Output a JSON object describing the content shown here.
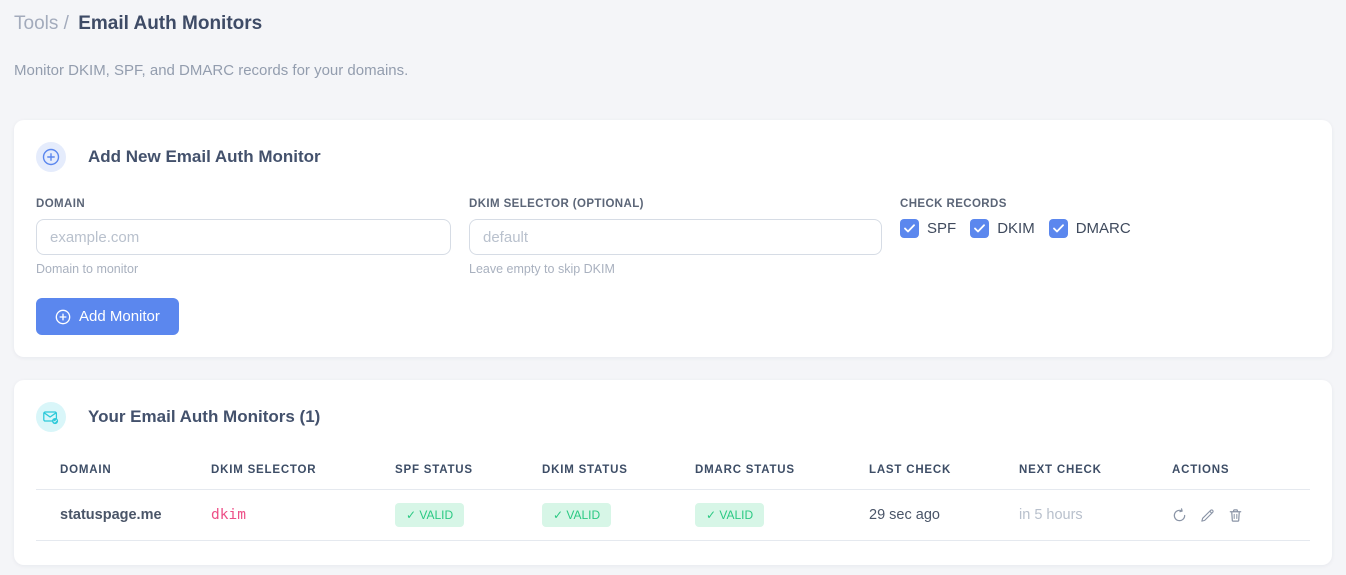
{
  "page": {
    "breadcrumb": {
      "section": "Tools",
      "separator": "/",
      "current": "Email Auth Monitors"
    },
    "subtitle": "Monitor DKIM, SPF, and DMARC records for your domains."
  },
  "add_monitor_card": {
    "title": "Add New Email Auth Monitor",
    "domain_field": {
      "label": "DOMAIN",
      "placeholder": "example.com",
      "value": "",
      "helper": "Domain to monitor"
    },
    "dkim_field": {
      "label": "DKIM SELECTOR (OPTIONAL)",
      "placeholder": "default",
      "value": "",
      "helper": "Leave empty to skip DKIM"
    },
    "check_records": {
      "label": "CHECK RECORDS",
      "options": [
        {
          "label": "SPF",
          "checked": true
        },
        {
          "label": "DKIM",
          "checked": true
        },
        {
          "label": "DMARC",
          "checked": true
        }
      ]
    },
    "submit_label": "Add Monitor"
  },
  "monitors_card": {
    "title": "Your Email Auth Monitors (1)",
    "count": 1,
    "table": {
      "headers": [
        "DOMAIN",
        "DKIM SELECTOR",
        "SPF STATUS",
        "DKIM STATUS",
        "DMARC STATUS",
        "LAST CHECK",
        "NEXT CHECK",
        "ACTIONS"
      ],
      "rows": [
        {
          "domain": "statuspage.me",
          "dkim_selector": "dkim",
          "spf_status": "✓ VALID",
          "dkim_status": "✓ VALID",
          "dmarc_status": "✓ VALID",
          "last_check": "29 sec ago",
          "next_check": "in 5 hours",
          "actions": [
            "refresh",
            "edit",
            "delete"
          ]
        }
      ]
    }
  },
  "colors": {
    "accent_blue": "#5b87ee",
    "accent_cyan": "#2bc9d9",
    "valid_green": "#2bc983",
    "valid_green_bg": "#d7f6e7",
    "selector_pink": "#ed4f87",
    "page_bg": "#f4f5f8"
  }
}
